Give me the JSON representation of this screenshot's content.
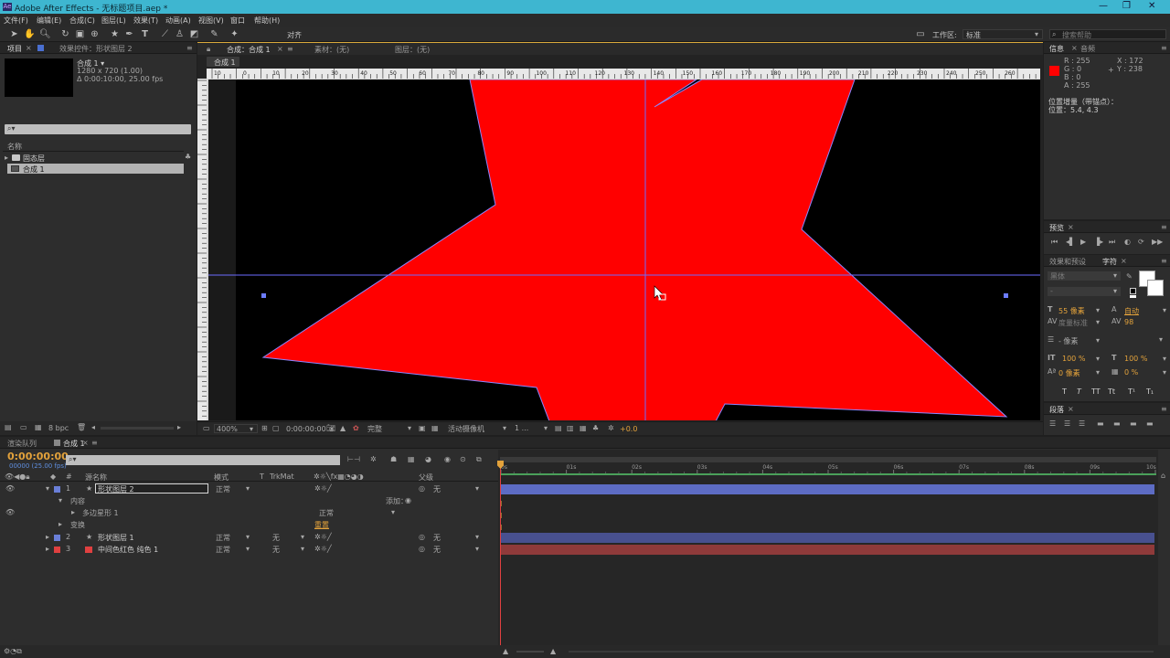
{
  "window": {
    "title": "Adobe After Effects - 无标题项目.aep *",
    "app_icon": "Ae"
  },
  "menu": [
    "文件(F)",
    "编辑(E)",
    "合成(C)",
    "图层(L)",
    "效果(T)",
    "动画(A)",
    "视图(V)",
    "窗口",
    "帮助(H)"
  ],
  "toolbar": {
    "align_label": "对齐",
    "workspace_label": "工作区:",
    "workspace_value": "标准",
    "search_placeholder": "搜索帮助"
  },
  "project_panel": {
    "tabs": [
      "项目",
      "效果控件：形状图层 2"
    ],
    "comp_name": "合成 1 ▾",
    "comp_size": "1280 x 720 (1.00)",
    "comp_duration": "Δ 0:00:10:00, 25.00 fps",
    "column_name": "名称",
    "items": [
      {
        "name": "固态层",
        "type": "folder"
      },
      {
        "name": "合成 1",
        "type": "comp"
      }
    ],
    "bpc": "8 bpc"
  },
  "comp_panel": {
    "tabs": [
      "合成：合成 1",
      "素材：(无)",
      "图层：(无)"
    ],
    "subtab": "合成 1",
    "ruler_labels": [
      "10",
      "0",
      "10",
      "20",
      "30",
      "40",
      "50",
      "60",
      "70",
      "80",
      "90",
      "100",
      "110",
      "120",
      "130",
      "140",
      "150",
      "160",
      "170",
      "180",
      "190",
      "200",
      "210",
      "220",
      "230",
      "240",
      "250",
      "260",
      "270",
      "280"
    ],
    "zoom": "400%",
    "timecode": "0:00:00:00",
    "resolution": "完整",
    "camera": "活动摄像机",
    "views": "1 ...",
    "exposure": "+0.0"
  },
  "info_panel": {
    "tabs": [
      "信息",
      "音频"
    ],
    "rgba": [
      "R : 255",
      "G : 0",
      "B : 0",
      "A : 255"
    ],
    "xy": [
      "X : 172",
      "Y : 238"
    ],
    "line1": "位置增量（带锚点）：",
    "line2": "位置：5.4, 4.3",
    "swatch_color": "#ff0000"
  },
  "preview_panel": {
    "tab": "预览"
  },
  "char_panel": {
    "tabs": [
      "效果和预设",
      "字符"
    ],
    "font_family": "黑体",
    "font_style": "-",
    "size": "55 像素",
    "leading": "自动",
    "kerning": "度量标准",
    "tracking": "98",
    "stroke": "- 像素",
    "v_scale": "100 %",
    "h_scale": "100 %",
    "baseline": "0 像素",
    "tsume": "0 %",
    "styles": [
      "T",
      "T",
      "TT",
      "Tt",
      "T¹",
      "T₁"
    ]
  },
  "paragraph_panel": {
    "tab": "段落"
  },
  "timeline": {
    "tabs": [
      "渲染队列",
      "合成 1"
    ],
    "timecode": "0:00:00:00",
    "fps": "00000 (25.00 fps)",
    "headers": {
      "num": "#",
      "name": "源名称",
      "mode": "模式",
      "t": "T",
      "trkmat": "TrkMat",
      "parent": "父级"
    },
    "ruler": [
      "0s",
      "01s",
      "02s",
      "03s",
      "04s",
      "05s",
      "06s",
      "07s",
      "08s",
      "09s",
      "10s"
    ],
    "layers": [
      {
        "num": "1",
        "name": "形状图层 2",
        "mode": "正常",
        "trkmat": "",
        "parent": "无",
        "color": "#6a7fd8",
        "bar": "#5d6cc4"
      },
      {
        "num": "2",
        "name": "形状图层 1",
        "mode": "正常",
        "trkmat": "无",
        "parent": "无",
        "color": "#6a7fd8",
        "bar": "#48508f"
      },
      {
        "num": "3",
        "name": "中间色红色 纯色 1",
        "mode": "正常",
        "trkmat": "无",
        "parent": "无",
        "color": "#e04040",
        "bar": "#8f3a3a"
      }
    ],
    "sub": {
      "contents": "内容",
      "add": "添加：",
      "polystar": "多边星形 1",
      "polystar_mode": "正常",
      "transform": "变换",
      "reset": "重置"
    }
  }
}
